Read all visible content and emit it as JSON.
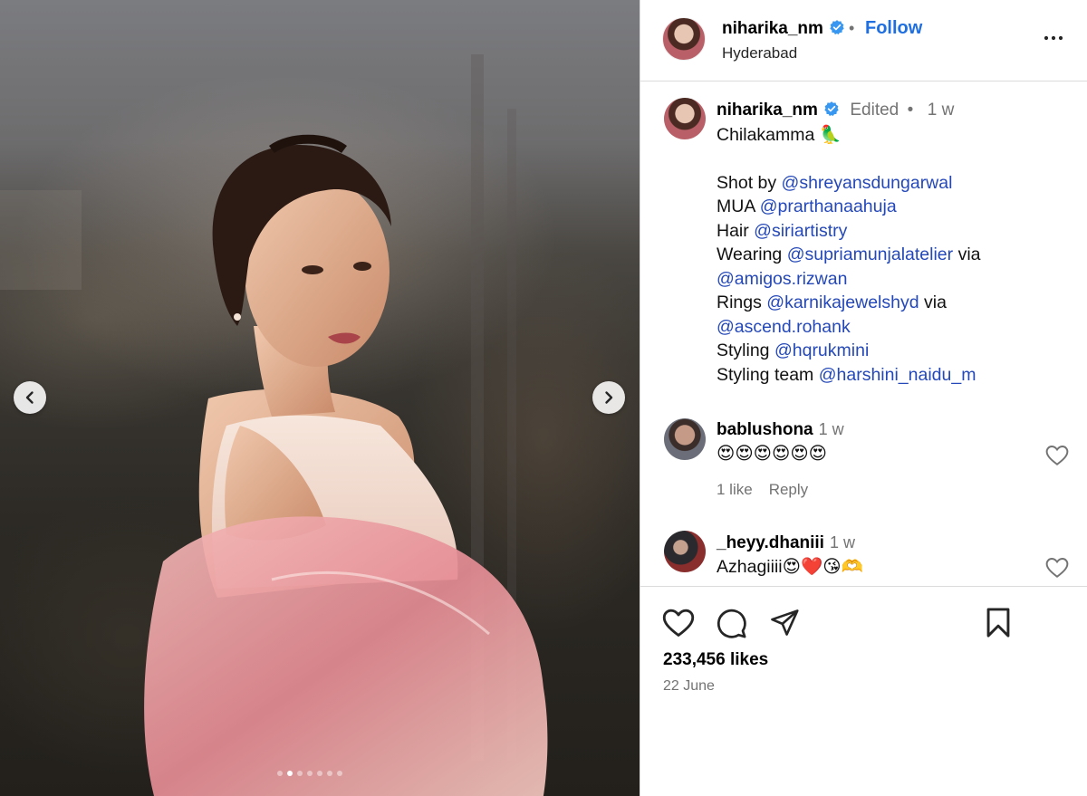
{
  "header": {
    "username": "niharika_nm",
    "separator": "•",
    "follow_label": "Follow",
    "location": "Hyderabad"
  },
  "caption": {
    "username": "niharika_nm",
    "edited": "Edited",
    "separator": "•",
    "time": "1 w",
    "lines": [
      {
        "text": "Chilakamma 🦜",
        "mention": "",
        "suffix": ""
      },
      {
        "text": "",
        "mention": "",
        "suffix": ""
      },
      {
        "text": "Shot by ",
        "mention": "@shreyansdungarwal",
        "suffix": ""
      },
      {
        "text": "MUA ",
        "mention": "@prarthanaahuja",
        "suffix": ""
      },
      {
        "text": "Hair ",
        "mention": "@siriartistry",
        "suffix": ""
      },
      {
        "text": "Wearing ",
        "mention": "@supriamunjalatelier",
        "suffix": " via"
      },
      {
        "text": "",
        "mention": "@amigos.rizwan",
        "suffix": ""
      },
      {
        "text": "Rings ",
        "mention": "@karnikajewelshyd",
        "suffix": " via"
      },
      {
        "text": "",
        "mention": "@ascend.rohank",
        "suffix": ""
      },
      {
        "text": "Styling ",
        "mention": "@hqrukmini",
        "suffix": ""
      },
      {
        "text": "Styling team ",
        "mention": "@harshini_naidu_m",
        "suffix": ""
      }
    ]
  },
  "comments": [
    {
      "username": "bablushona",
      "time": "1 w",
      "text": "😍😍😍😍😍😍",
      "likes": "1 like",
      "reply": "Reply"
    },
    {
      "username": "_heyy.dhaniii",
      "time": "1 w",
      "text": "Azhagiiii😍❤️😘🫶",
      "likes": "",
      "reply": ""
    }
  ],
  "stats": {
    "likes": "233,456 likes",
    "date": "22 June"
  },
  "carousel": {
    "slide_count": 7,
    "active_index": 1
  },
  "icons": {
    "prev": "chevron-left-icon",
    "next": "chevron-right-icon",
    "more": "more-options-icon",
    "like": "heart-icon",
    "comment": "comment-icon",
    "share": "share-icon",
    "save": "bookmark-icon",
    "verified": "verified-badge-icon"
  },
  "colors": {
    "link": "#2448b8",
    "follow": "#1f6fe0",
    "verified": "#3897f0",
    "muted": "#737373"
  }
}
